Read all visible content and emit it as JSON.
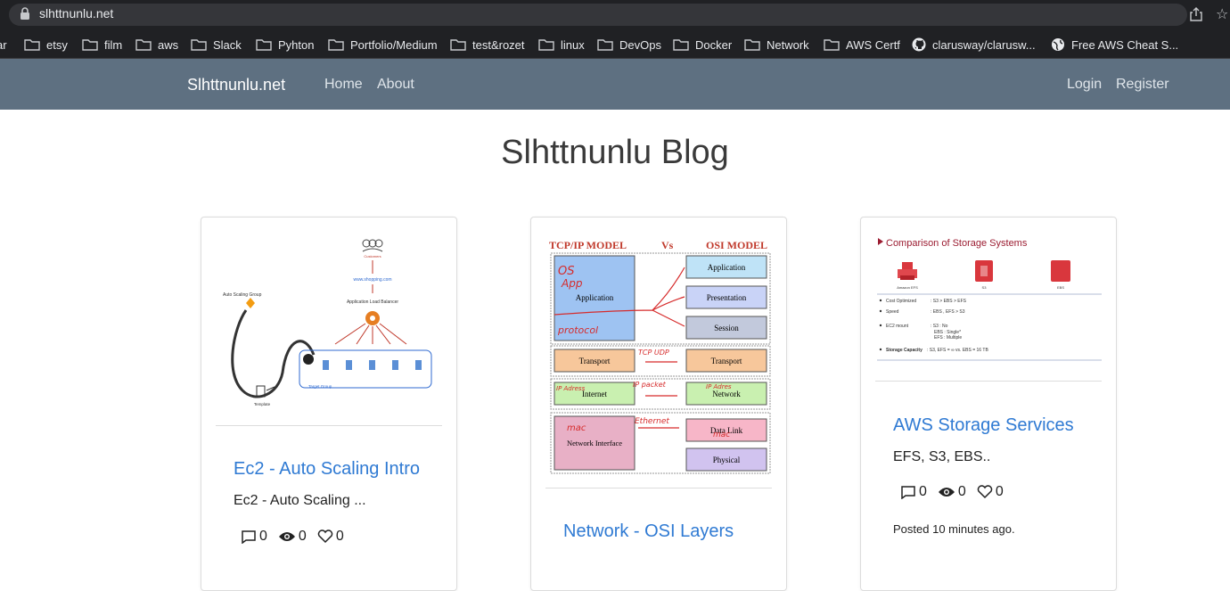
{
  "browser": {
    "url": "slhttnunlu.net",
    "bookmarks": [
      {
        "label": "ar",
        "icon": "folder-icon"
      },
      {
        "label": "etsy",
        "icon": "folder-icon"
      },
      {
        "label": "film",
        "icon": "folder-icon"
      },
      {
        "label": "aws",
        "icon": "folder-icon"
      },
      {
        "label": "Slack",
        "icon": "folder-icon"
      },
      {
        "label": "Pyhton",
        "icon": "folder-icon"
      },
      {
        "label": "Portfolio/Medium",
        "icon": "folder-icon"
      },
      {
        "label": "test&rozet",
        "icon": "folder-icon"
      },
      {
        "label": "linux",
        "icon": "folder-icon"
      },
      {
        "label": "DevOps",
        "icon": "folder-icon"
      },
      {
        "label": "Docker",
        "icon": "folder-icon"
      },
      {
        "label": "Network",
        "icon": "folder-icon"
      },
      {
        "label": "AWS Certf",
        "icon": "folder-icon"
      },
      {
        "label": "clarusway/clarusw...",
        "icon": "github-icon"
      },
      {
        "label": "Free AWS Cheat S...",
        "icon": "globe-icon"
      }
    ]
  },
  "nav": {
    "brand": "Slhttnunlu.net",
    "home": "Home",
    "about": "About",
    "login": "Login",
    "register": "Register"
  },
  "page": {
    "title": "Slhttnunlu Blog"
  },
  "cards": [
    {
      "title": "Ec2 - Auto Scaling Intro",
      "desc": "Ec2 - Auto Scaling ...",
      "comments": "0",
      "views": "0",
      "likes": "0",
      "thumb": {
        "labels": [
          "Auto Scaling Group",
          "www.shopping.com",
          "Application Load Balancer",
          "Target Group",
          "Template",
          "Customers"
        ]
      }
    },
    {
      "title": "Network - OSI Layers",
      "thumb": {
        "heading_left": "TCP/IP MODEL",
        "heading_vs": "Vs",
        "heading_right": "OSI MODEL",
        "left_layers": [
          "Application",
          "Transport",
          "Internet",
          "Network Interface"
        ],
        "right_layers": [
          "Application",
          "Presentation",
          "Session",
          "Transport",
          "Network",
          "Data Link",
          "Physical"
        ],
        "notes": [
          "OS",
          "App",
          "protocol",
          "TCP UDP",
          "IP packet",
          "IP Adress",
          "IP Adres",
          "mac",
          "Ethernet",
          "mac"
        ]
      }
    },
    {
      "title": "AWS Storage Services",
      "desc": "EFS, S3, EBS..",
      "comments": "0",
      "views": "0",
      "likes": "0",
      "posted": "Posted 10 minutes ago.",
      "thumb": {
        "heading": "Comparison of Storage Systems",
        "icons": [
          "Amazon EFS",
          "S3",
          "EBS"
        ],
        "rows": [
          {
            "label": "Cost Optimized",
            "value": ": S3 > EBS > EFS"
          },
          {
            "label": "Speed",
            "value": ": EBS , EFS > S3"
          },
          {
            "label": "EC2 mount",
            "value": ": S3 : No"
          },
          {
            "label": "",
            "value": "EBS : Single*"
          },
          {
            "label": "",
            "value": "EFS : Multiple"
          },
          {
            "label": "Storage Capacity",
            "value": ": S3, EFS = ∞ vs. EBS = 16 TB"
          }
        ]
      }
    }
  ],
  "colors": {
    "navbar": "#5e7081",
    "link": "#2f7ad3"
  }
}
